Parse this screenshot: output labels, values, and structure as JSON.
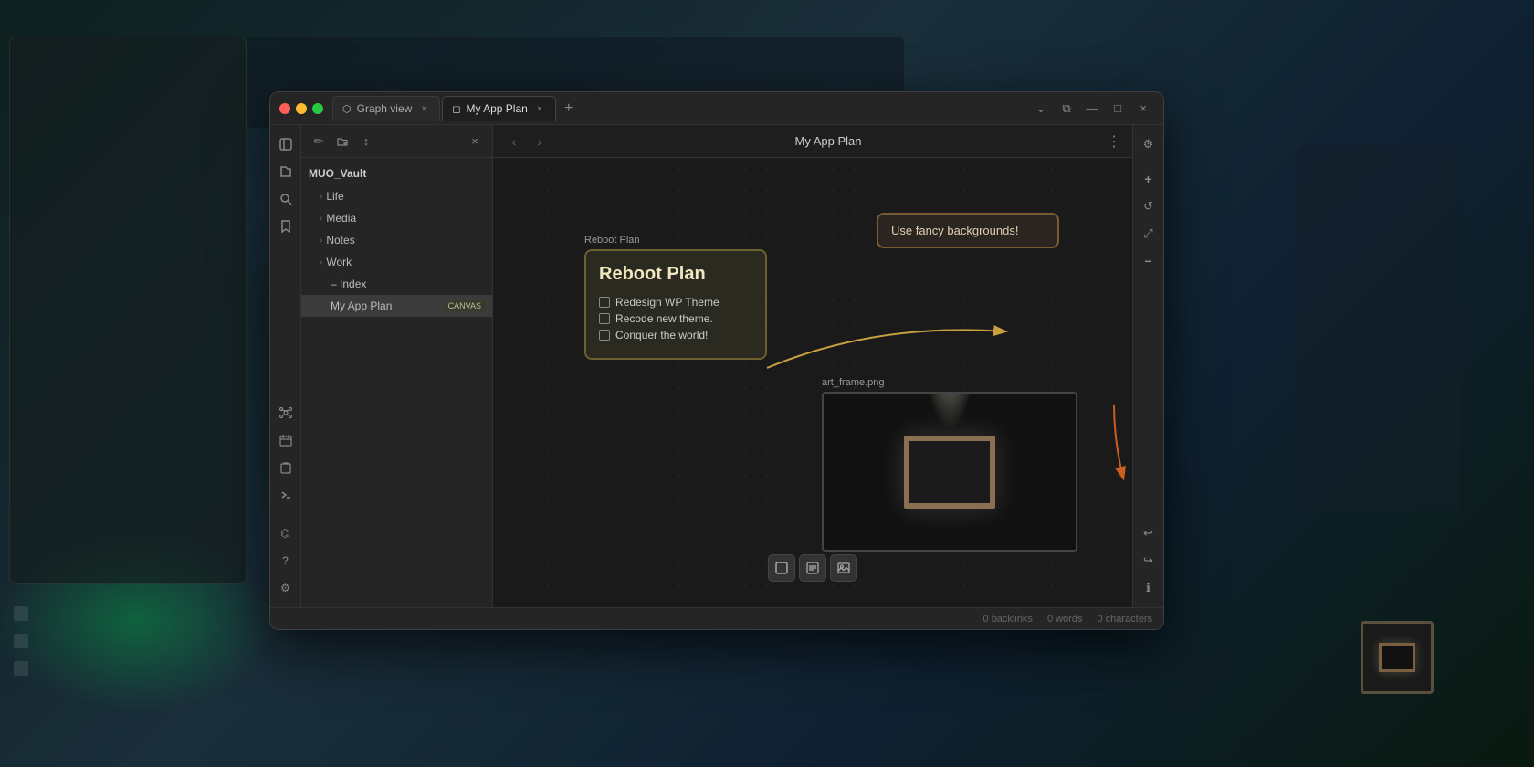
{
  "background": {
    "description": "Blurred background with dark teal/green gradient"
  },
  "window": {
    "title": "My App Plan",
    "tabs": [
      {
        "id": "graph-view",
        "label": "Graph view",
        "icon": "⬡",
        "active": false,
        "closable": true
      },
      {
        "id": "my-app-plan",
        "label": "My App Plan",
        "icon": "◻",
        "active": true,
        "closable": true
      }
    ],
    "controls": {
      "chevron_down": "⌄",
      "split": "⧉",
      "minimize": "—",
      "maximize": "□",
      "close": "×"
    }
  },
  "ribbon": {
    "items": [
      {
        "id": "sidebar-toggle",
        "icon": "▤",
        "active": false
      },
      {
        "id": "files",
        "icon": "📁",
        "active": false
      },
      {
        "id": "search",
        "icon": "🔍",
        "active": false
      },
      {
        "id": "bookmark",
        "icon": "🔖",
        "active": false
      }
    ],
    "active": "files",
    "bottom": [
      {
        "id": "graph",
        "icon": "⬡"
      },
      {
        "id": "calendar",
        "icon": "📅"
      },
      {
        "id": "clipboard",
        "icon": "📋"
      },
      {
        "id": "terminal",
        "icon": ">"
      }
    ],
    "footer": [
      {
        "id": "vault",
        "icon": "⌬"
      },
      {
        "id": "help",
        "icon": "?"
      },
      {
        "id": "settings",
        "icon": "⚙"
      }
    ]
  },
  "sidebar": {
    "toolbar": {
      "new_note": "✏",
      "new_folder": "📁",
      "sort": "↕",
      "close": "×"
    },
    "vault_name": "MUO_Vault",
    "tree": [
      {
        "id": "life",
        "label": "Life",
        "indent": 1,
        "arrow": "›",
        "type": "folder"
      },
      {
        "id": "media",
        "label": "Media",
        "indent": 1,
        "arrow": "›",
        "type": "folder"
      },
      {
        "id": "notes",
        "label": "Notes",
        "indent": 1,
        "arrow": "›",
        "type": "folder"
      },
      {
        "id": "work",
        "label": "Work",
        "indent": 1,
        "arrow": "›",
        "type": "folder"
      },
      {
        "id": "index",
        "label": "– Index",
        "indent": 2,
        "type": "file"
      },
      {
        "id": "my-app-plan",
        "label": "My App Plan",
        "indent": 2,
        "type": "canvas",
        "badge": "CANVAS",
        "active": true
      }
    ]
  },
  "content": {
    "nav": {
      "back": "‹",
      "forward": "›"
    },
    "title": "My App Plan",
    "more": "⋮"
  },
  "canvas": {
    "nodes": {
      "reboot_plan": {
        "label": "Reboot Plan",
        "title": "Reboot Plan",
        "items": [
          {
            "id": "item1",
            "text": "Redesign WP Theme",
            "checked": false
          },
          {
            "id": "item2",
            "text": "Recode new theme.",
            "checked": false
          },
          {
            "id": "item3",
            "text": "Conquer the world!",
            "checked": false
          }
        ]
      },
      "fancy_bg": {
        "text": "Use fancy backgrounds!"
      },
      "art_frame": {
        "label": "art_frame.png"
      }
    },
    "tools": {
      "add_card": "⧉",
      "add_note": "📄",
      "add_media": "🖼"
    }
  },
  "right_panel": {
    "buttons": [
      {
        "id": "settings",
        "icon": "⚙"
      },
      {
        "id": "zoom_in",
        "icon": "+"
      },
      {
        "id": "refresh",
        "icon": "↺"
      },
      {
        "id": "fit",
        "icon": "⤢"
      },
      {
        "id": "zoom_out",
        "icon": "−"
      },
      {
        "id": "undo",
        "icon": "↩"
      },
      {
        "id": "redo",
        "icon": "↪"
      },
      {
        "id": "info",
        "icon": "ℹ"
      }
    ]
  },
  "status_bar": {
    "backlinks": "0 backlinks",
    "words": "0 words",
    "characters": "0 characters"
  }
}
